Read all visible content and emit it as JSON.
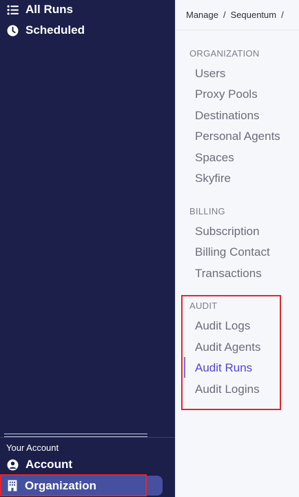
{
  "sidebar": {
    "nav": [
      {
        "label": "All Runs",
        "icon": "list-icon"
      },
      {
        "label": "Scheduled",
        "icon": "clock-icon"
      }
    ],
    "account_section": {
      "heading": "Your Account",
      "items": [
        {
          "label": "Account",
          "icon": "user-circle-icon"
        },
        {
          "label": "Organization",
          "icon": "building-icon",
          "active": true
        }
      ]
    }
  },
  "breadcrumb": {
    "items": [
      "Manage",
      "Sequentum"
    ],
    "separator": "/"
  },
  "settings_menu": {
    "groups": [
      {
        "title": "ORGANIZATION",
        "items": [
          "Users",
          "Proxy Pools",
          "Destinations",
          "Personal Agents",
          "Spaces",
          "Skyfire"
        ]
      },
      {
        "title": "BILLING",
        "items": [
          "Subscription",
          "Billing Contact",
          "Transactions"
        ]
      },
      {
        "title": "AUDIT",
        "items": [
          "Audit Logs",
          "Audit Agents",
          "Audit Runs",
          "Audit Logins"
        ]
      }
    ],
    "active_item": "Audit Runs"
  },
  "colors": {
    "sidebar_bg": "#1b1f4a",
    "sidebar_active_bg": "#4550a0",
    "panel_bg": "#f6f7fa",
    "active_link": "#5045d6",
    "highlight_outline": "#e1252f"
  }
}
